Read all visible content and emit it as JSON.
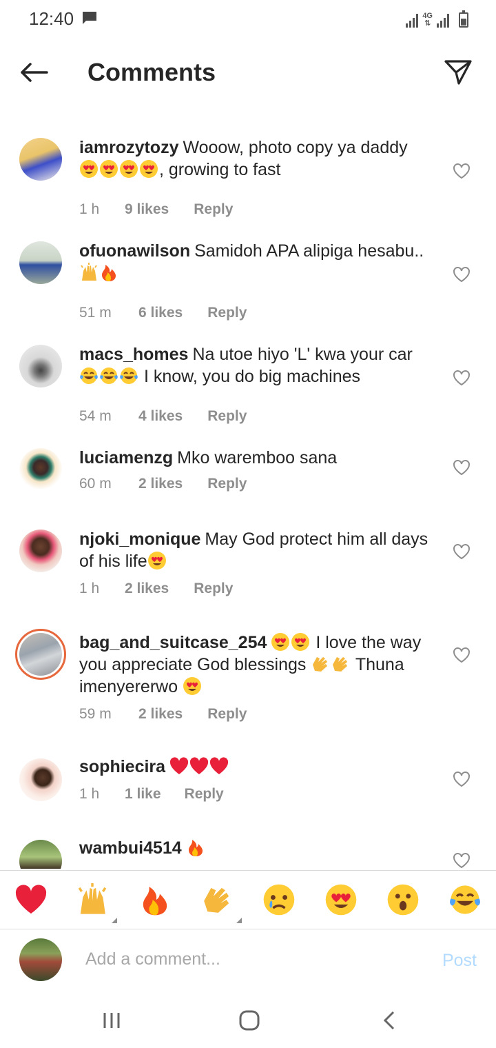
{
  "status": {
    "time": "12:40",
    "network": "4G"
  },
  "header": {
    "title": "Comments",
    "back_icon": "arrow-left-icon",
    "send_icon": "paper-plane-icon"
  },
  "comments": [
    {
      "username": "iamrozytozy",
      "text_a": "Wooow, photo copy ya daddy",
      "emoji_a": [
        "heart-eyes",
        "heart-eyes",
        "heart-eyes",
        "heart-eyes"
      ],
      "text_b": ", growing to fast",
      "time": "1 h",
      "likes": "9 likes",
      "reply": "Reply"
    },
    {
      "username": "ofuonawilson",
      "text_a": "Samidoh APA alipiga hesabu..",
      "emoji_a": [
        "raised-hands",
        "fire"
      ],
      "text_b": "",
      "time": "51 m",
      "likes": "6 likes",
      "reply": "Reply"
    },
    {
      "username": "macs_homes",
      "text_a": "Na utoe hiyo 'L' kwa your car",
      "emoji_a": [
        "tears-of-joy",
        "tears-of-joy",
        "tears-of-joy"
      ],
      "text_b": " I know, you do big machines",
      "time": "54 m",
      "likes": "4 likes",
      "reply": "Reply"
    },
    {
      "username": "luciamenzg",
      "text_a": "Mko waremboo sana",
      "emoji_a": [],
      "text_b": "",
      "time": "60 m",
      "likes": "2 likes",
      "reply": "Reply"
    },
    {
      "username": "njoki_monique",
      "text_a": "May God protect him all days of his life",
      "emoji_a": [
        "heart-eyes"
      ],
      "text_b": "",
      "time": "1 h",
      "likes": "2 likes",
      "reply": "Reply"
    },
    {
      "username": "bag_and_suitcase_254",
      "text_a": "",
      "emoji_a": [
        "heart-eyes",
        "heart-eyes"
      ],
      "text_b": " I love the way you appreciate God blessings",
      "emoji_b": [
        "clapping",
        "clapping"
      ],
      "text_c": " Thuna imenyererwo ",
      "emoji_c": [
        "heart-eyes"
      ],
      "time": "59 m",
      "likes": "2 likes",
      "reply": "Reply"
    },
    {
      "username": "sophiecira",
      "text_a": "",
      "emoji_a": [
        "red-heart",
        "red-heart",
        "red-heart"
      ],
      "text_b": "",
      "time": "1 h",
      "likes": "1 like",
      "reply": "Reply"
    },
    {
      "username": "wambui4514",
      "text_a": "",
      "emoji_a": [
        "fire"
      ],
      "text_b": "",
      "time": "",
      "likes": "",
      "reply": ""
    }
  ],
  "emoji_bar": [
    "red-heart",
    "raised-hands",
    "fire",
    "clapping",
    "crying-face",
    "heart-eyes",
    "surprised-face",
    "tears-of-joy"
  ],
  "add_comment": {
    "placeholder": "Add a comment...",
    "post_label": "Post"
  },
  "colors": {
    "accent_disabled": "#b3dbff",
    "secondary_text": "#8e8e8e",
    "story_ring": "#e6683c"
  }
}
